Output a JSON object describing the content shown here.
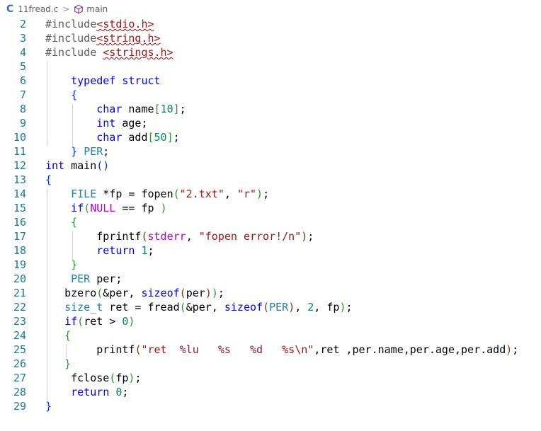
{
  "breadcrumb": {
    "file_icon": "C",
    "file_name": "11fread.c",
    "separator": ">",
    "symbol_icon": "cube-icon",
    "symbol_name": "main"
  },
  "lines": [
    {
      "n": "2",
      "tokens": [
        {
          "t": "#include",
          "c": "pp"
        },
        {
          "t": "<stdio.h>",
          "c": "str squig"
        }
      ]
    },
    {
      "n": "3",
      "tokens": [
        {
          "t": "#include",
          "c": "pp"
        },
        {
          "t": "<string.h>",
          "c": "str squig"
        }
      ]
    },
    {
      "n": "4",
      "tokens": [
        {
          "t": "#include ",
          "c": "pp"
        },
        {
          "t": "<strings.h>",
          "c": "str squig"
        }
      ]
    },
    {
      "n": "5",
      "tokens": []
    },
    {
      "n": "6",
      "tokens": [
        {
          "t": "    "
        },
        {
          "t": "typedef",
          "c": "kw"
        },
        {
          "t": " "
        },
        {
          "t": "struct",
          "c": "kw"
        }
      ]
    },
    {
      "n": "7",
      "tokens": [
        {
          "t": "    "
        },
        {
          "t": "{",
          "c": "brk1"
        }
      ]
    },
    {
      "n": "8",
      "tokens": [
        {
          "t": "        "
        },
        {
          "t": "char",
          "c": "kw"
        },
        {
          "t": " name"
        },
        {
          "t": "[",
          "c": "brk2"
        },
        {
          "t": "10",
          "c": "num"
        },
        {
          "t": "]",
          "c": "brk2"
        },
        {
          "t": ";"
        }
      ]
    },
    {
      "n": "9",
      "tokens": [
        {
          "t": "        "
        },
        {
          "t": "int",
          "c": "kw"
        },
        {
          "t": " age;"
        }
      ]
    },
    {
      "n": "10",
      "tokens": [
        {
          "t": "        "
        },
        {
          "t": "char",
          "c": "kw"
        },
        {
          "t": " add"
        },
        {
          "t": "[",
          "c": "brk2"
        },
        {
          "t": "50",
          "c": "num"
        },
        {
          "t": "]",
          "c": "brk2"
        },
        {
          "t": ";"
        }
      ]
    },
    {
      "n": "11",
      "tokens": [
        {
          "t": "    "
        },
        {
          "t": "}",
          "c": "brk1"
        },
        {
          "t": " "
        },
        {
          "t": "PER",
          "c": "ty"
        },
        {
          "t": ";"
        }
      ]
    },
    {
      "n": "12",
      "tokens": [
        {
          "t": "int",
          "c": "kw"
        },
        {
          "t": " main"
        },
        {
          "t": "()",
          "c": "brk1"
        }
      ]
    },
    {
      "n": "13",
      "tokens": [
        {
          "t": "{",
          "c": "brk1"
        }
      ]
    },
    {
      "n": "14",
      "tokens": [
        {
          "t": "    "
        },
        {
          "t": "FILE",
          "c": "ty"
        },
        {
          "t": " *fp = fopen"
        },
        {
          "t": "(",
          "c": "brk2"
        },
        {
          "t": "\"2.txt\"",
          "c": "str"
        },
        {
          "t": ", "
        },
        {
          "t": "\"r\"",
          "c": "str"
        },
        {
          "t": ")",
          "c": "brk2"
        },
        {
          "t": ";"
        }
      ]
    },
    {
      "n": "15",
      "tokens": [
        {
          "t": "    "
        },
        {
          "t": "if",
          "c": "kw"
        },
        {
          "t": "(",
          "c": "brk2"
        },
        {
          "t": "NULL",
          "c": "mac"
        },
        {
          "t": " == fp "
        },
        {
          "t": ")",
          "c": "brk2"
        }
      ]
    },
    {
      "n": "16",
      "tokens": [
        {
          "t": "    "
        },
        {
          "t": "{",
          "c": "brk2"
        }
      ]
    },
    {
      "n": "17",
      "tokens": [
        {
          "t": "        fprintf"
        },
        {
          "t": "(",
          "c": "brk3"
        },
        {
          "t": "stderr",
          "c": "mac"
        },
        {
          "t": ", "
        },
        {
          "t": "\"fopen error!/n\"",
          "c": "str"
        },
        {
          "t": ")",
          "c": "brk3"
        },
        {
          "t": ";"
        }
      ]
    },
    {
      "n": "18",
      "tokens": [
        {
          "t": "        "
        },
        {
          "t": "return",
          "c": "kw"
        },
        {
          "t": " "
        },
        {
          "t": "1",
          "c": "num"
        },
        {
          "t": ";"
        }
      ]
    },
    {
      "n": "19",
      "tokens": [
        {
          "t": "    "
        },
        {
          "t": "}",
          "c": "brk2"
        }
      ]
    },
    {
      "n": "20",
      "tokens": [
        {
          "t": "    "
        },
        {
          "t": "PER",
          "c": "ty"
        },
        {
          "t": " per;"
        }
      ]
    },
    {
      "n": "21",
      "tokens": [
        {
          "t": "   bzero"
        },
        {
          "t": "(",
          "c": "brk2"
        },
        {
          "t": "&per, "
        },
        {
          "t": "sizeof",
          "c": "kw"
        },
        {
          "t": "(",
          "c": "brk3"
        },
        {
          "t": "per"
        },
        {
          "t": ")",
          "c": "brk3"
        },
        {
          "t": ")",
          "c": "brk2"
        },
        {
          "t": ";"
        }
      ]
    },
    {
      "n": "22",
      "tokens": [
        {
          "t": "   "
        },
        {
          "t": "size_t",
          "c": "ty"
        },
        {
          "t": " ret = fread"
        },
        {
          "t": "(",
          "c": "brk2"
        },
        {
          "t": "&per, "
        },
        {
          "t": "sizeof",
          "c": "kw"
        },
        {
          "t": "(",
          "c": "brk3"
        },
        {
          "t": "PER",
          "c": "ty"
        },
        {
          "t": ")",
          "c": "brk3"
        },
        {
          "t": ", "
        },
        {
          "t": "2",
          "c": "num"
        },
        {
          "t": ", fp"
        },
        {
          "t": ")",
          "c": "brk2"
        },
        {
          "t": ";"
        }
      ]
    },
    {
      "n": "23",
      "tokens": [
        {
          "t": "   "
        },
        {
          "t": "if",
          "c": "kw"
        },
        {
          "t": "(",
          "c": "brk2"
        },
        {
          "t": "ret > "
        },
        {
          "t": "0",
          "c": "num"
        },
        {
          "t": ")",
          "c": "brk2"
        }
      ]
    },
    {
      "n": "24",
      "tokens": [
        {
          "t": "   "
        },
        {
          "t": "{",
          "c": "brk2"
        }
      ]
    },
    {
      "n": "25",
      "tokens": [
        {
          "t": "        printf"
        },
        {
          "t": "(",
          "c": "brk3"
        },
        {
          "t": "\"ret  ",
          "c": "str"
        },
        {
          "t": "%lu",
          "c": "fmt"
        },
        {
          "t": "   ",
          "c": "str"
        },
        {
          "t": "%s",
          "c": "fmt"
        },
        {
          "t": "   ",
          "c": "str"
        },
        {
          "t": "%d",
          "c": "fmt"
        },
        {
          "t": "   ",
          "c": "str"
        },
        {
          "t": "%s\\n\"",
          "c": "str"
        },
        {
          "t": ",ret ,per.name,per.age,per.add"
        },
        {
          "t": ")",
          "c": "brk3"
        },
        {
          "t": ";"
        }
      ]
    },
    {
      "n": "26",
      "tokens": [
        {
          "t": "   "
        },
        {
          "t": "}",
          "c": "brk2"
        }
      ]
    },
    {
      "n": "27",
      "tokens": [
        {
          "t": "    fclose"
        },
        {
          "t": "(",
          "c": "brk2"
        },
        {
          "t": "fp"
        },
        {
          "t": ")",
          "c": "brk2"
        },
        {
          "t": ";"
        }
      ]
    },
    {
      "n": "28",
      "tokens": [
        {
          "t": "    "
        },
        {
          "t": "return",
          "c": "kw"
        },
        {
          "t": " "
        },
        {
          "t": "0",
          "c": "num"
        },
        {
          "t": ";"
        }
      ]
    },
    {
      "n": "29",
      "tokens": [
        {
          "t": "}",
          "c": "brk1"
        }
      ]
    }
  ]
}
